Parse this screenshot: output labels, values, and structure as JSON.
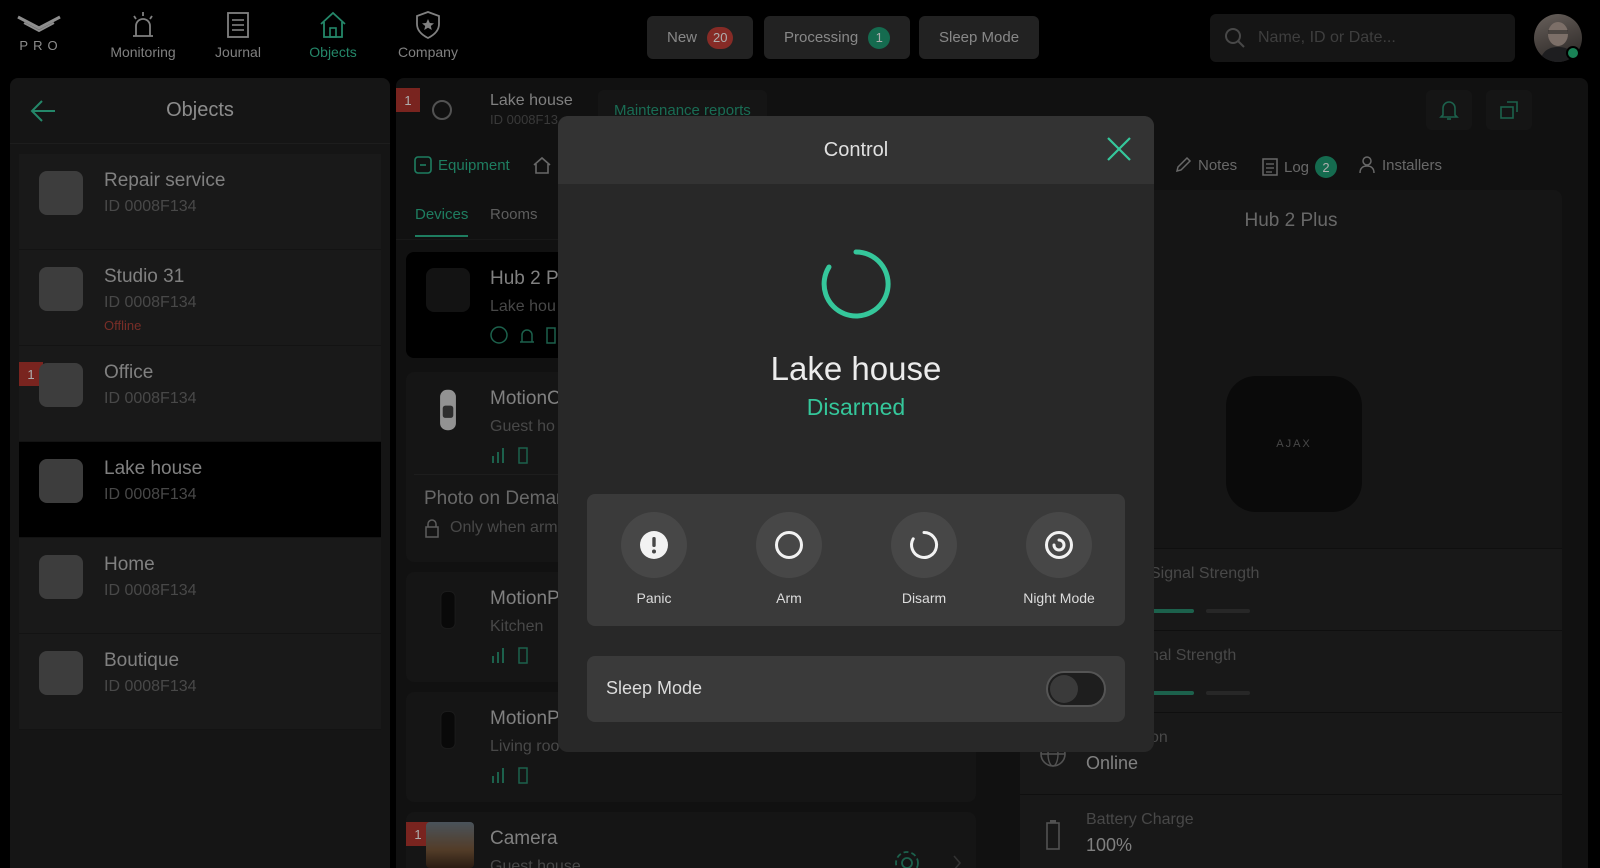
{
  "topbar": {
    "logo_text": "PRO",
    "nav": [
      {
        "label": "Monitoring",
        "icon": "siren-icon"
      },
      {
        "label": "Journal",
        "icon": "journal-icon"
      },
      {
        "label": "Objects",
        "icon": "home-icon"
      },
      {
        "label": "Company",
        "icon": "shield-star-icon"
      }
    ],
    "pills": [
      {
        "label": "New",
        "count": "20"
      },
      {
        "label": "Processing",
        "count": "1"
      },
      {
        "label": "Sleep Mode"
      }
    ],
    "search_placeholder": "Name, ID or Date..."
  },
  "objects_panel": {
    "title": "Objects",
    "items": [
      {
        "name": "Repair service",
        "id": "ID 0008F134"
      },
      {
        "name": "Studio 31",
        "id": "ID 0008F134",
        "status": "Offline"
      },
      {
        "name": "Office",
        "id": "ID 0008F134",
        "alert": "1"
      },
      {
        "name": "Lake house",
        "id": "ID 0008F134",
        "selected": true
      },
      {
        "name": "Home",
        "id": "ID 0008F134"
      },
      {
        "name": "Boutique",
        "id": "ID 0008F134"
      }
    ]
  },
  "object_header": {
    "alert": "1",
    "name": "Lake house",
    "id": "ID 0008F13",
    "maintenance_label": "Maintenance reports"
  },
  "tabs": {
    "equipment": "Equipment",
    "notes": "Notes",
    "log": "Log",
    "log_count": "2",
    "installers": "Installers"
  },
  "subtabs": {
    "devices": "Devices",
    "rooms": "Rooms"
  },
  "devices": [
    {
      "name": "Hub 2 P",
      "room": "Lake hou"
    },
    {
      "name": "MotionC",
      "room": "Guest ho"
    },
    {
      "name": "MotionP",
      "room": "Kitchen"
    },
    {
      "name": "MotionP",
      "room": "Living roo"
    },
    {
      "name": "Camera",
      "room": "Guest house",
      "alert": "1"
    }
  ],
  "photo_on_demand": {
    "title": "Photo on Deman",
    "subtitle": "Only when arm"
  },
  "hub_info": {
    "title": "Hub 2 Plus",
    "logo_text": "AJAX",
    "rows": [
      {
        "label": "Signal Strength"
      },
      {
        "label": "nal Strength"
      },
      {
        "label": "on",
        "value": "Online"
      },
      {
        "label": "Battery Charge",
        "value": "100%"
      }
    ]
  },
  "modal": {
    "title": "Control",
    "object_name": "Lake house",
    "state": "Disarmed",
    "actions": [
      {
        "label": "Panic",
        "icon": "exclamation-icon"
      },
      {
        "label": "Arm",
        "icon": "ring-icon"
      },
      {
        "label": "Disarm",
        "icon": "partial-ring-icon"
      },
      {
        "label": "Night Mode",
        "icon": "moon-ring-icon"
      }
    ],
    "sleep_mode_label": "Sleep Mode",
    "sleep_mode_on": false
  },
  "colors": {
    "accent": "#35C79B",
    "alert": "#B3362F",
    "badge_red": "#C64038"
  }
}
